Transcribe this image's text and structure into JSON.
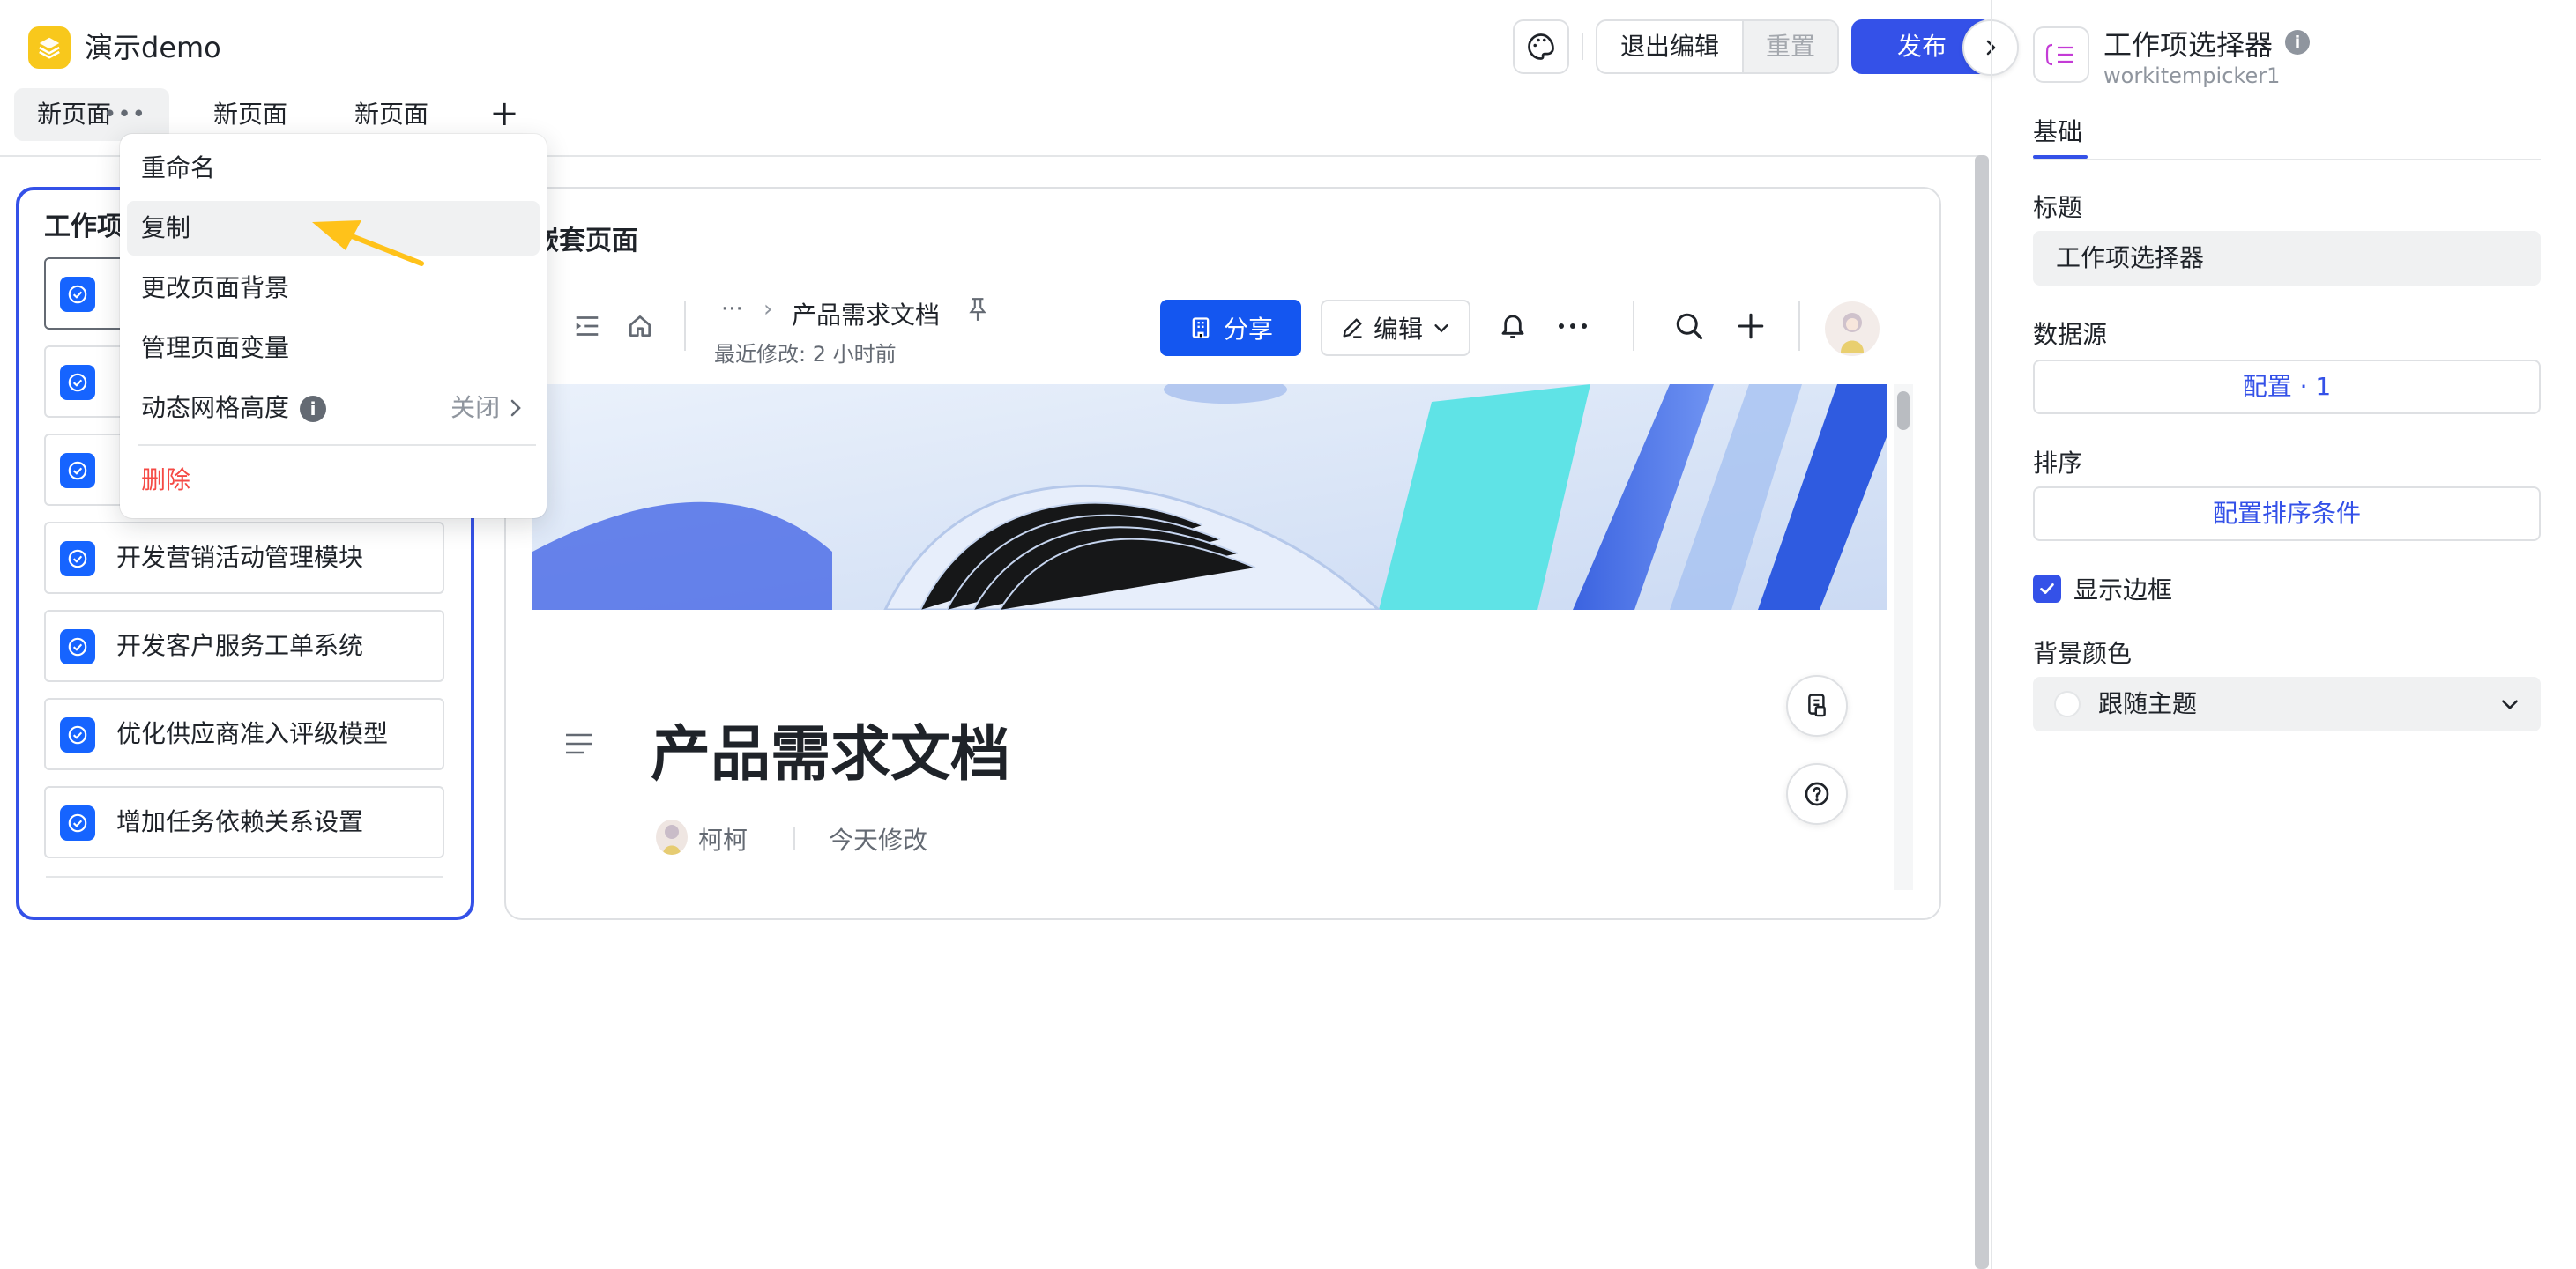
{
  "app": {
    "title": "演示demo",
    "exit_edit_label": "退出编辑",
    "reset_label": "重置",
    "publish_label": "发布"
  },
  "tabs": [
    {
      "label": "新页面",
      "active": true,
      "more": "•••"
    },
    {
      "label": "新页面",
      "active": false
    },
    {
      "label": "新页面",
      "active": false
    }
  ],
  "tab_add": "+",
  "context_menu": {
    "items": [
      {
        "label": "重命名"
      },
      {
        "label": "复制",
        "hover": true
      },
      {
        "label": "更改页面背景"
      },
      {
        "label": "管理页面变量"
      },
      {
        "label": "动态网格高度",
        "info": "i",
        "value": "关闭"
      },
      {
        "label": "删除",
        "danger": true
      }
    ]
  },
  "work_item_list": {
    "title": "工作项",
    "items": [
      {
        "label": ""
      },
      {
        "label": ""
      },
      {
        "label": ""
      },
      {
        "label": "开发营销活动管理模块"
      },
      {
        "label": "开发客户服务工单系统"
      },
      {
        "label": "优化供应商准入评级模型"
      },
      {
        "label": "增加任务依赖关系设置"
      }
    ]
  },
  "embed": {
    "title": "嵌套页面",
    "doc": {
      "breadcrumb_dots": "···",
      "breadcrumb_chevron": "›",
      "name": "产品需求文档",
      "last_modified": "最近修改: 2 小时前",
      "share_label": "分享",
      "edit_label": "编辑",
      "heading": "产品需求文档",
      "author": "柯柯",
      "edited": "今天修改"
    }
  },
  "panel": {
    "component_name": "工作项选择器",
    "component_id": "workitempicker1",
    "info": "i",
    "tab": "基础",
    "title_label": "标题",
    "title_value": "工作项选择器",
    "datasource_label": "数据源",
    "datasource_button": "配置 · 1",
    "sort_label": "排序",
    "sort_button": "配置排序条件",
    "show_border_label": "显示边框",
    "show_border_checked": true,
    "bg_color_label": "背景颜色",
    "bg_color_value": "跟随主题"
  },
  "colors": {
    "accent": "#3451e8",
    "share_blue": "#1456f0",
    "danger": "#f54a45",
    "logo_yellow": "#f8c81c",
    "arrow_yellow": "#ffc21a"
  }
}
